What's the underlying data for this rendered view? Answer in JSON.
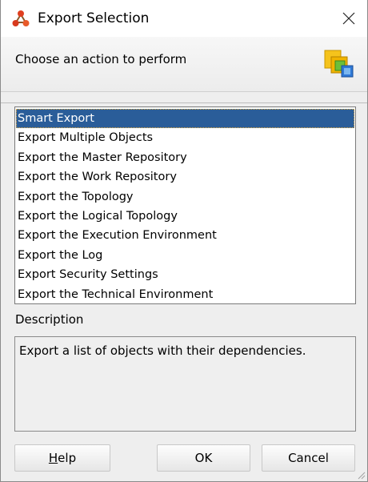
{
  "window": {
    "title": "Export Selection",
    "icons": {
      "app": "odi-network-icon",
      "close": "close-icon"
    }
  },
  "header": {
    "prompt": "Choose an action to perform",
    "icon": "export-documents-icon"
  },
  "actions": {
    "selected_index": 0,
    "items": [
      "Smart Export",
      "Export Multiple Objects",
      "Export the Master Repository",
      "Export the Work Repository",
      "Export the Topology",
      "Export the Logical Topology",
      "Export the Execution Environment",
      "Export the Log",
      "Export Security Settings",
      "Export the Technical Environment"
    ]
  },
  "description": {
    "label": "Description",
    "text": "Export a list of objects with their dependencies."
  },
  "buttons": {
    "help_mnemonic": "H",
    "help_rest": "elp",
    "ok": "OK",
    "cancel": "Cancel"
  },
  "colors": {
    "selection": "#2a5d99",
    "selection_focus": "#f0b040"
  }
}
